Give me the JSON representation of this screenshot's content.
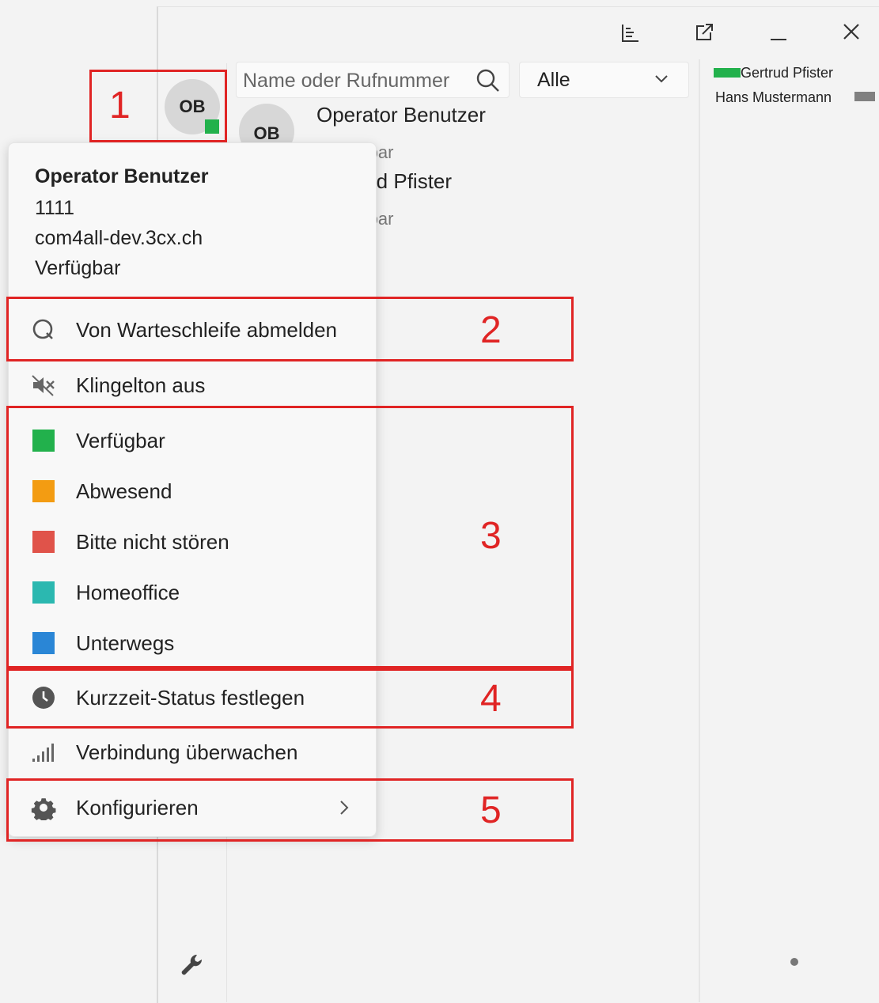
{
  "titlebar": {
    "icons": [
      "chart-icon",
      "popout-icon",
      "minimize-icon",
      "close-icon"
    ]
  },
  "search": {
    "placeholder": "Name oder Rufnummer"
  },
  "filter": {
    "selected": "Alle"
  },
  "user_avatar": {
    "initials": "OB"
  },
  "contacts": [
    {
      "initials": "OB",
      "name": "Operator Benutzer",
      "status": "Verfügbar"
    },
    {
      "name": "Gertrud Pfister",
      "status": "Verfügbar"
    }
  ],
  "presence_panel": [
    {
      "name": "Gertrud Pfister",
      "color": "#22b14c"
    },
    {
      "name": "Hans Mustermann",
      "color": "#808080"
    }
  ],
  "menu": {
    "user_name": "Operator Benutzer",
    "extension": "1111",
    "domain": "com4all-dev.3cx.ch",
    "status": "Verfügbar",
    "queue_logout": "Von Warteschleife abmelden",
    "ringtone_off": "Klingelton aus",
    "statuses": [
      {
        "label": "Verfügbar",
        "color": "#22b14c"
      },
      {
        "label": "Abwesend",
        "color": "#f39c12"
      },
      {
        "label": "Bitte nicht stören",
        "color": "#e0534a"
      },
      {
        "label": "Homeoffice",
        "color": "#2bb8b0"
      },
      {
        "label": "Unterwegs",
        "color": "#2a86d6"
      }
    ],
    "temp_status": "Kurzzeit-Status festlegen",
    "monitor_connection": "Verbindung überwachen",
    "configure": "Konfigurieren"
  },
  "annotations": [
    "1",
    "2",
    "3",
    "4",
    "5"
  ]
}
